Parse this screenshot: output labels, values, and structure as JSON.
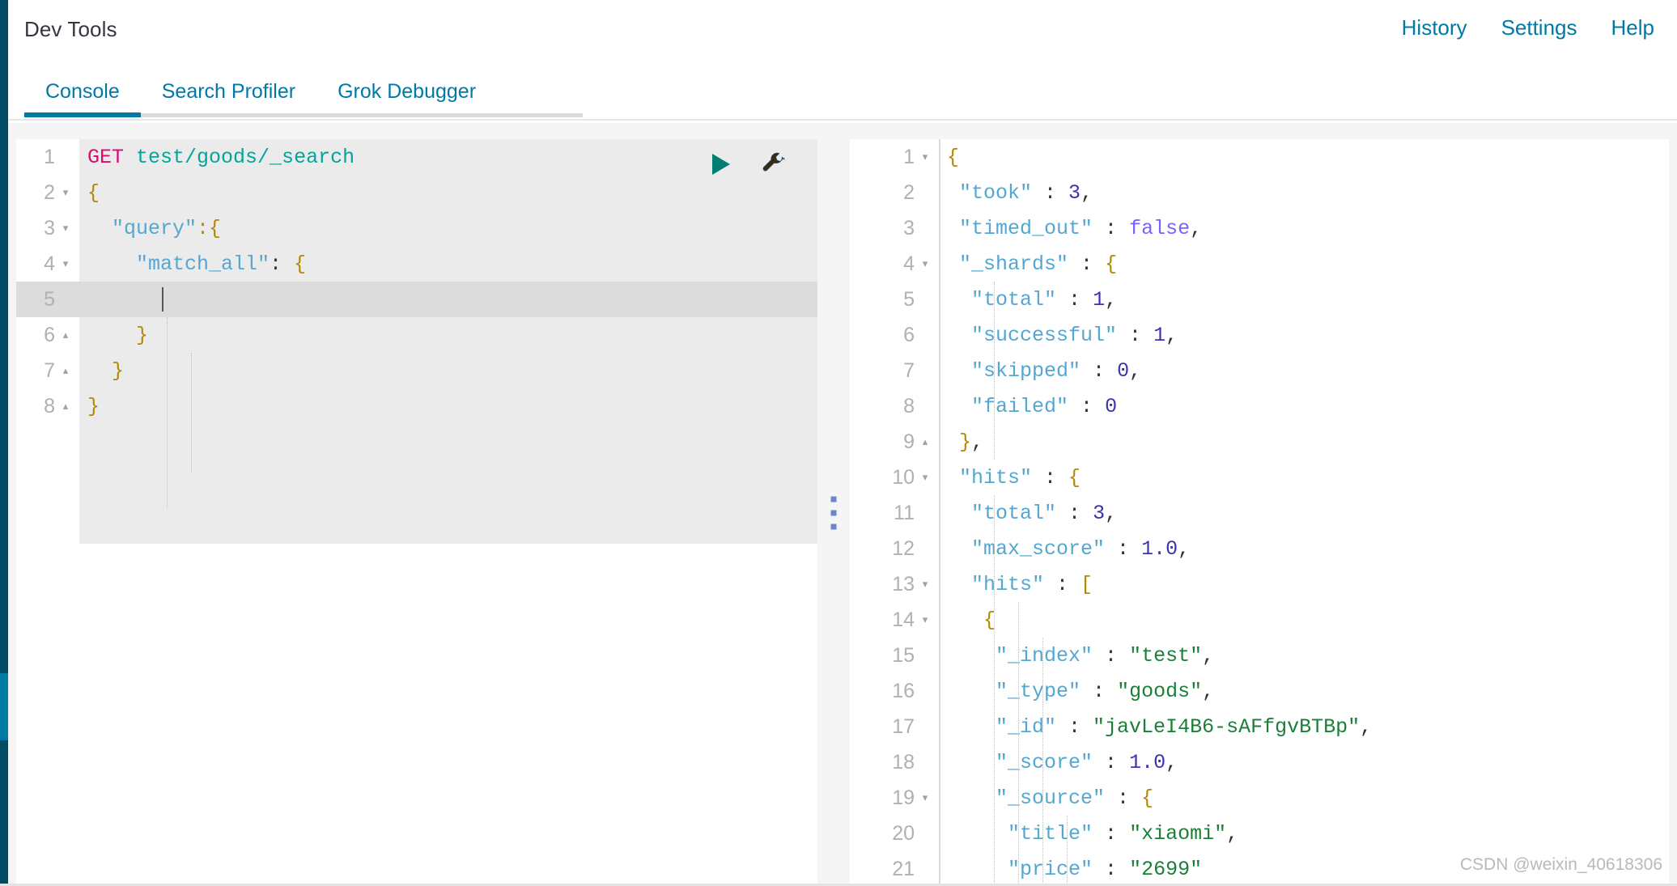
{
  "colors": {
    "rail_dark": "#014b63",
    "rail_light": "#0079a5",
    "accent": "#0079a5",
    "method": "#dd0a73",
    "url": "#00a69b",
    "string": "#1a7f37",
    "number": "#3b33b1",
    "boolean": "#7b61ff",
    "key": "#54a7d0",
    "run": "#017d73"
  },
  "header": {
    "title": "Dev Tools",
    "nav": [
      {
        "label": "History",
        "name": "history-link"
      },
      {
        "label": "Settings",
        "name": "settings-link"
      },
      {
        "label": "Help",
        "name": "help-link"
      }
    ]
  },
  "tabs": [
    {
      "label": "Console",
      "active": true
    },
    {
      "label": "Search Profiler",
      "active": false
    },
    {
      "label": "Grok Debugger",
      "active": false
    }
  ],
  "request_editor": {
    "actions": {
      "run_label": "▶",
      "run_icon": "play-icon",
      "wrench_icon": "wrench-icon"
    },
    "active_line": 5,
    "lines": [
      {
        "n": "1",
        "fold": "",
        "text": "GET test/goods/_search"
      },
      {
        "n": "2",
        "fold": "▾",
        "text": "{"
      },
      {
        "n": "3",
        "fold": "▾",
        "text": "  \"query\":{"
      },
      {
        "n": "4",
        "fold": "▾",
        "text": "    \"match_all\": {"
      },
      {
        "n": "5",
        "fold": "",
        "text": "      "
      },
      {
        "n": "6",
        "fold": "▴",
        "text": "    }"
      },
      {
        "n": "7",
        "fold": "▴",
        "text": "  }"
      },
      {
        "n": "8",
        "fold": "▴",
        "text": "}"
      }
    ]
  },
  "response_editor": {
    "lines": [
      {
        "n": "1",
        "fold": "▾",
        "text": "{"
      },
      {
        "n": "2",
        "fold": "",
        "text": "  \"took\" : 3,"
      },
      {
        "n": "3",
        "fold": "",
        "text": "  \"timed_out\" : false,"
      },
      {
        "n": "4",
        "fold": "▾",
        "text": "  \"_shards\" : {"
      },
      {
        "n": "5",
        "fold": "",
        "text": "    \"total\" : 1,"
      },
      {
        "n": "6",
        "fold": "",
        "text": "    \"successful\" : 1,"
      },
      {
        "n": "7",
        "fold": "",
        "text": "    \"skipped\" : 0,"
      },
      {
        "n": "8",
        "fold": "",
        "text": "    \"failed\" : 0"
      },
      {
        "n": "9",
        "fold": "▴",
        "text": "  },"
      },
      {
        "n": "10",
        "fold": "▾",
        "text": "  \"hits\" : {"
      },
      {
        "n": "11",
        "fold": "",
        "text": "    \"total\" : 3,"
      },
      {
        "n": "12",
        "fold": "",
        "text": "    \"max_score\" : 1.0,"
      },
      {
        "n": "13",
        "fold": "▾",
        "text": "    \"hits\" : ["
      },
      {
        "n": "14",
        "fold": "▾",
        "text": "      {"
      },
      {
        "n": "15",
        "fold": "",
        "text": "        \"_index\" : \"test\","
      },
      {
        "n": "16",
        "fold": "",
        "text": "        \"_type\" : \"goods\","
      },
      {
        "n": "17",
        "fold": "",
        "text": "        \"_id\" : \"javLeI4B6-sAFfgvBTBp\","
      },
      {
        "n": "18",
        "fold": "",
        "text": "        \"_score\" : 1.0,"
      },
      {
        "n": "19",
        "fold": "▾",
        "text": "        \"_source\" : {"
      },
      {
        "n": "20",
        "fold": "",
        "text": "          \"title\" : \"xiaomi\","
      },
      {
        "n": "21",
        "fold": "",
        "text": "          \"price\" : \"2699\""
      }
    ],
    "response_data": {
      "took": 3,
      "timed_out": false,
      "_shards": {
        "total": 1,
        "successful": 1,
        "skipped": 0,
        "failed": 0
      },
      "hits": {
        "total": 3,
        "max_score": 1.0,
        "hits": [
          {
            "_index": "test",
            "_type": "goods",
            "_id": "javLeI4B6-sAFfgvBTBp",
            "_score": 1.0,
            "_source": {
              "title": "xiaomi",
              "price": "2699"
            }
          }
        ]
      }
    }
  },
  "splitter": {
    "handle_icon": "grip-vertical-icon"
  },
  "watermark": {
    "text": "CSDN @weixin_40618306"
  }
}
